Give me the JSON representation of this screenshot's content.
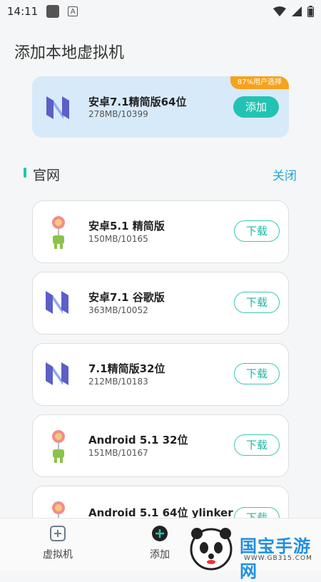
{
  "statusbar": {
    "time": "14:11",
    "a_icon_letter": "A"
  },
  "page": {
    "title": "添加本地虚拟机"
  },
  "featured": {
    "badge": "87%用户选择",
    "title": "安卓7.1精简版64位",
    "subtitle": "278MB/10399",
    "button": "添加",
    "icon": "android-nougat-icon"
  },
  "section": {
    "title": "官网",
    "close": "关闭"
  },
  "items": [
    {
      "title": "安卓5.1 精简版",
      "subtitle": "150MB/10165",
      "button": "下载",
      "icon": "android-lollipop-icon"
    },
    {
      "title": "安卓7.1 谷歌版",
      "subtitle": "363MB/10052",
      "button": "下载",
      "icon": "android-nougat-icon"
    },
    {
      "title": "7.1精简版32位",
      "subtitle": "212MB/10183",
      "button": "下载",
      "icon": "android-nougat-icon"
    },
    {
      "title": "Android 5.1 32位",
      "subtitle": "151MB/10167",
      "button": "下载",
      "icon": "android-lollipop-icon"
    },
    {
      "title": "Android 5.1 64位 ylinker",
      "subtitle": "",
      "button": "下载",
      "icon": "android-lollipop-icon"
    }
  ],
  "bottomnav": {
    "vm": "虚拟机",
    "add": "添加"
  },
  "watermark": {
    "brand": "国宝手游网",
    "url": "WWW.GB315.COM"
  },
  "colors": {
    "accent": "#22c3b2",
    "hero_bg": "#d7eaf9",
    "badge": "#f6a21d",
    "link": "#22a7d8"
  }
}
